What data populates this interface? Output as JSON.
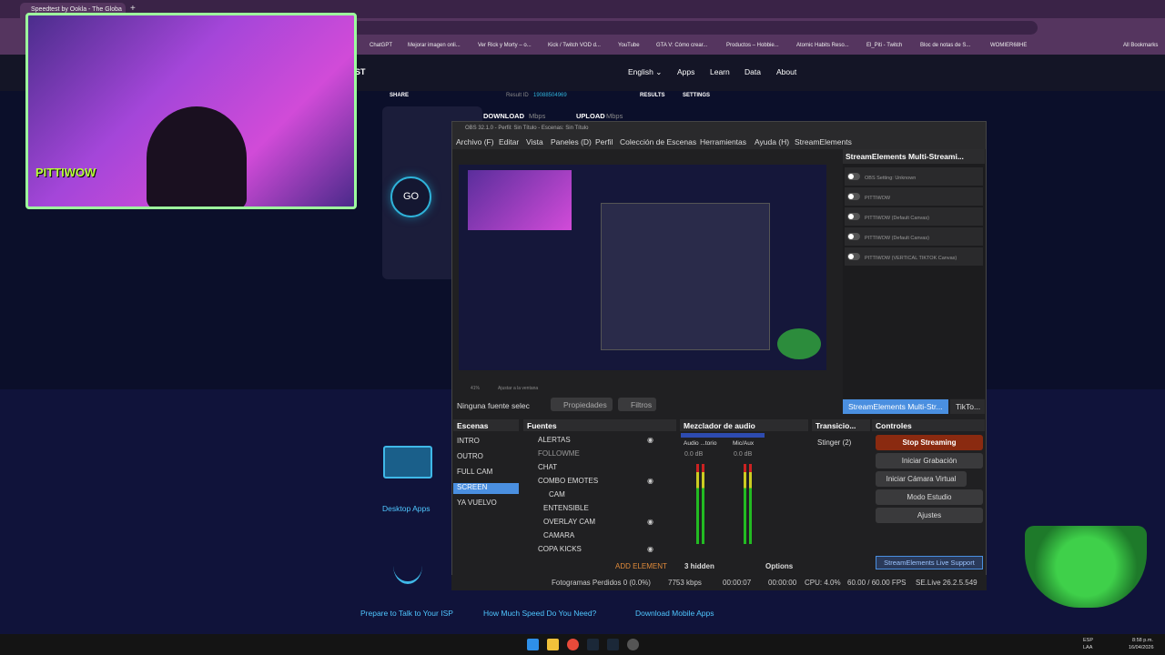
{
  "browser": {
    "tab_title": "Speedtest by Ookla - The Globa",
    "new_tab": "+",
    "bookmarks": [
      "ChatGPT",
      "Mejorar imagen onli...",
      "Ver Rick y Morty – o...",
      "Kick / Twitch VOD d...",
      "YouTube",
      "GTA V: Cómo crear...",
      "Productos – Hobbie...",
      "Atomic Habits Reso...",
      "El_Piti - Twitch",
      "Bloc de notas de S...",
      "WOMIER68HE"
    ],
    "all_bookmarks": "All Bookmarks"
  },
  "site": {
    "logo_tail": "ST",
    "nav": [
      "English ⌄",
      "Apps",
      "Learn",
      "Data",
      "About"
    ],
    "share": "SHARE",
    "result_id_label": "Result ID",
    "result_id": "19088504969",
    "results": "RESULTS",
    "settings": "SETTINGS",
    "download": "DOWNLOAD",
    "download_unit": "Mbps",
    "upload": "UPLOAD",
    "upload_unit": "Mbps",
    "go": "GO",
    "desktop_apps": "Desktop Apps",
    "footer_links": [
      "Prepare to Talk to Your ISP",
      "How Much Speed Do You Need?",
      "Download Mobile Apps"
    ]
  },
  "webcam": {
    "sign": "PITTIWOW"
  },
  "obs": {
    "title": "OBS 32.1.0 - Perfil: Sin Título - Escenas: Sin Título",
    "menu": [
      "Archivo (F)",
      "Editar",
      "Vista",
      "Paneles (D)",
      "Perfil",
      "Colección de Escenas",
      "Herramientas",
      "Ayuda (H)",
      "StreamElements"
    ],
    "zoom": "41%",
    "zoom_mode": "Ajustar a la ventana",
    "no_source": "Ninguna fuente selec",
    "properties": "Propiedades",
    "filters": "Filtros",
    "scenes_title": "Escenas",
    "scenes": [
      "INTRO",
      "OUTRO",
      "FULL CAM",
      "SCREEN",
      "YA VUELVO"
    ],
    "active_scene": "SCREEN",
    "sources_title": "Fuentes",
    "sources": [
      "ALERTAS",
      "FOLLOWME",
      "CHAT",
      "COMBO EMOTES",
      "CAM",
      "ENTENSIBLE",
      "OVERLAY CAM",
      "CAMARA",
      "COPA KICKS"
    ],
    "add_element": "ADD ELEMENT",
    "mixer_title": "Mezclador de audio",
    "mixer_ch1": "Audio ...torio",
    "mixer_ch2": "Mic/Aux",
    "mixer_db1": "0.0 dB",
    "mixer_db2": "0.0 dB",
    "hidden": "3 hidden",
    "options": "Options",
    "transitions_title": "Transicio...",
    "transition": "Stinger (2)",
    "controls_title": "Controles",
    "controls": [
      "Stop Streaming",
      "Iniciar Grabación",
      "Iniciar Cámara Virtual",
      "Modo Estudio",
      "Ajustes"
    ],
    "se_panel_title": "StreamElements Multi-Streami...",
    "se_rows": [
      "OBS Setting: Unknown",
      "PITTIWOW",
      "PITTIWOW (Default Canvas)",
      "PITTIWOW (Default Canvas)",
      "PITTIWOW (VERTICAL TIKTOK Canvas)"
    ],
    "se_tabs": [
      "StreamElements Multi-Str...",
      "TikTo..."
    ],
    "live_support": "StreamElements Live Support",
    "status": {
      "dropped": "Fotogramas Perdidos 0 (0.0%)",
      "kbps": "7753 kbps",
      "time1": "00:00:07",
      "time2": "00:00:00",
      "cpu": "CPU: 4.0%",
      "fps": "60.00 / 60.00 FPS",
      "version": "SE.Live 26.2.5.549"
    }
  },
  "taskbar": {
    "lang": "ESP",
    "lang2": "LAA",
    "time": "8:58 p.m.",
    "date": "16/04/2026"
  },
  "colors": {
    "accent": "#2fb2d9",
    "stop": "#8a2a10",
    "select": "#4a8fe0"
  }
}
